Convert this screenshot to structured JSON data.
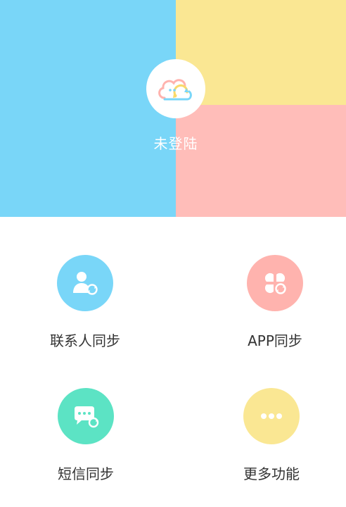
{
  "user": {
    "status_label": "未登陆"
  },
  "colors": {
    "blue": "#79D6F8",
    "yellow": "#FAE793",
    "pink": "#FFBDB9",
    "green": "#5CE3C4",
    "label_text": "#333333"
  },
  "features": [
    {
      "label": "联系人同步",
      "icon": "contact-sync-icon",
      "color": "#79D6F8"
    },
    {
      "label": "APP同步",
      "icon": "app-sync-icon",
      "color": "#FFB3AE"
    },
    {
      "label": "短信同步",
      "icon": "sms-sync-icon",
      "color": "#5CE3C4"
    },
    {
      "label": "更多功能",
      "icon": "more-icon",
      "color": "#FAE793"
    }
  ]
}
